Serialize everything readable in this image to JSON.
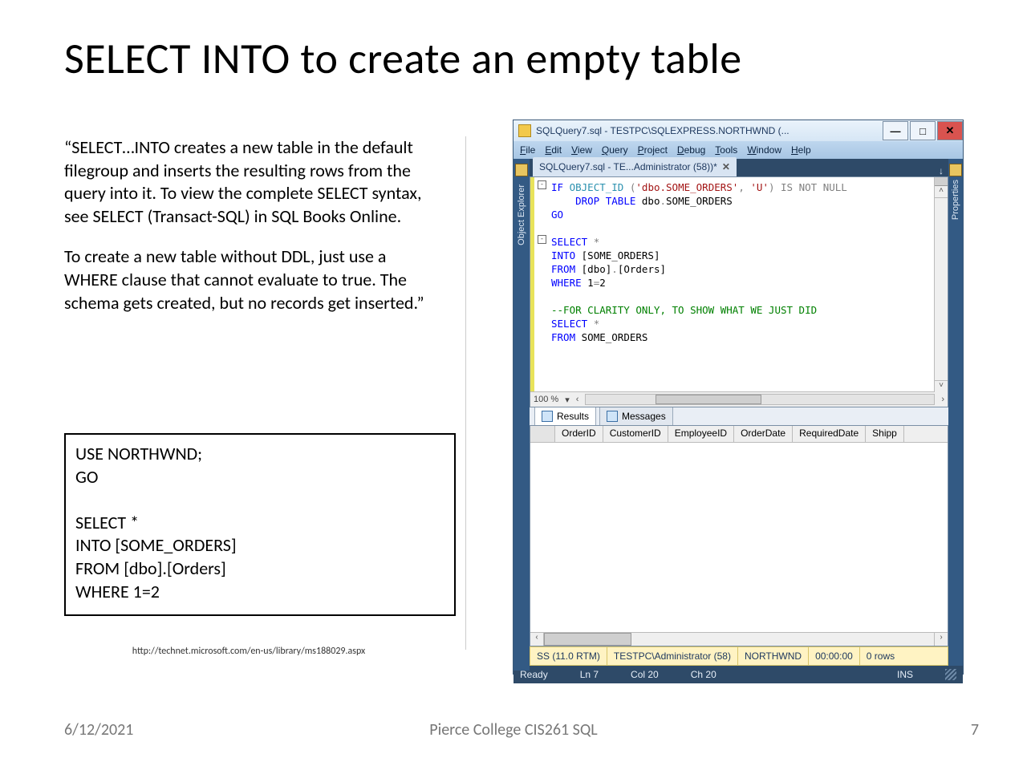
{
  "slide": {
    "title": "SELECT INTO to create an empty table",
    "para1": "“SELECT…INTO creates a new table in the default filegroup and inserts the resulting rows from the query into it. To view the complete SELECT syntax, see SELECT (Transact-SQL) in SQL Books Online.",
    "para2": "To create a new table without DDL, just use a WHERE clause that cannot evaluate to true. The schema gets created, but no records get inserted.”",
    "code": "USE NORTHWND;\nGO\n\nSELECT *\nINTO [SOME_ORDERS]\nFROM [dbo].[Orders]\nWHERE 1=2",
    "cite": "http://technet.microsoft.com/en-us/library/ms188029.aspx",
    "footer_date": "6/12/2021",
    "footer_center": "Pierce College CIS261 SQL",
    "footer_page": "7"
  },
  "ssms": {
    "window_title": "SQLQuery7.sql - TESTPC\\SQLEXPRESS.NORTHWND (...",
    "minimize": "—",
    "maximize": "□",
    "close": "✕",
    "menus": [
      "File",
      "Edit",
      "View",
      "Query",
      "Project",
      "Debug",
      "Tools",
      "Window",
      "Help"
    ],
    "leftrail": "Object Explorer",
    "rightrail": "Properties",
    "doc_tab": "SQLQuery7.sql - TE...Administrator (58))*",
    "doc_tab_close": "✕",
    "tabbar_right": "↓",
    "zoom": "100 %",
    "zoom_arrow": "▾",
    "results_tab": "Results",
    "messages_tab": "Messages",
    "grid_cols": [
      "OrderID",
      "CustomerID",
      "EmployeeID",
      "OrderDate",
      "RequiredDate",
      "Shipp"
    ],
    "conn": {
      "server": "SS (11.0 RTM)",
      "user": "TESTPC\\Administrator (58)",
      "db": "NORTHWND",
      "time": "00:00:00",
      "rows": "0 rows"
    },
    "status": {
      "ready": "Ready",
      "ln": "Ln 7",
      "col": "Col 20",
      "ch": "Ch 20",
      "ins": "INS"
    },
    "sql": {
      "l1a": "IF",
      "l1b": "OBJECT_ID",
      "l1c": "(",
      "l1d": "'dbo.SOME_ORDERS'",
      "l1e": ",",
      "l1f": "'U'",
      "l1g": ")",
      "l1h": "IS NOT NULL",
      "l2a": "DROP TABLE",
      "l2b": "dbo",
      "l2c": ".",
      "l2d": "SOME_ORDERS",
      "l3": "GO",
      "l5a": "SELECT",
      "l5b": "*",
      "l6a": "INTO",
      "l6b": "[SOME_ORDERS]",
      "l7a": "FROM",
      "l7b": "[dbo]",
      "l7c": ".",
      "l7d": "[Orders]",
      "l8a": "WHERE",
      "l8b": "1",
      "l8c": "=",
      "l8d": "2",
      "l10": "--FOR CLARITY ONLY, TO SHOW WHAT WE JUST DID",
      "l11a": "SELECT",
      "l11b": "*",
      "l12a": "FROM",
      "l12b": "SOME_ORDERS"
    }
  }
}
